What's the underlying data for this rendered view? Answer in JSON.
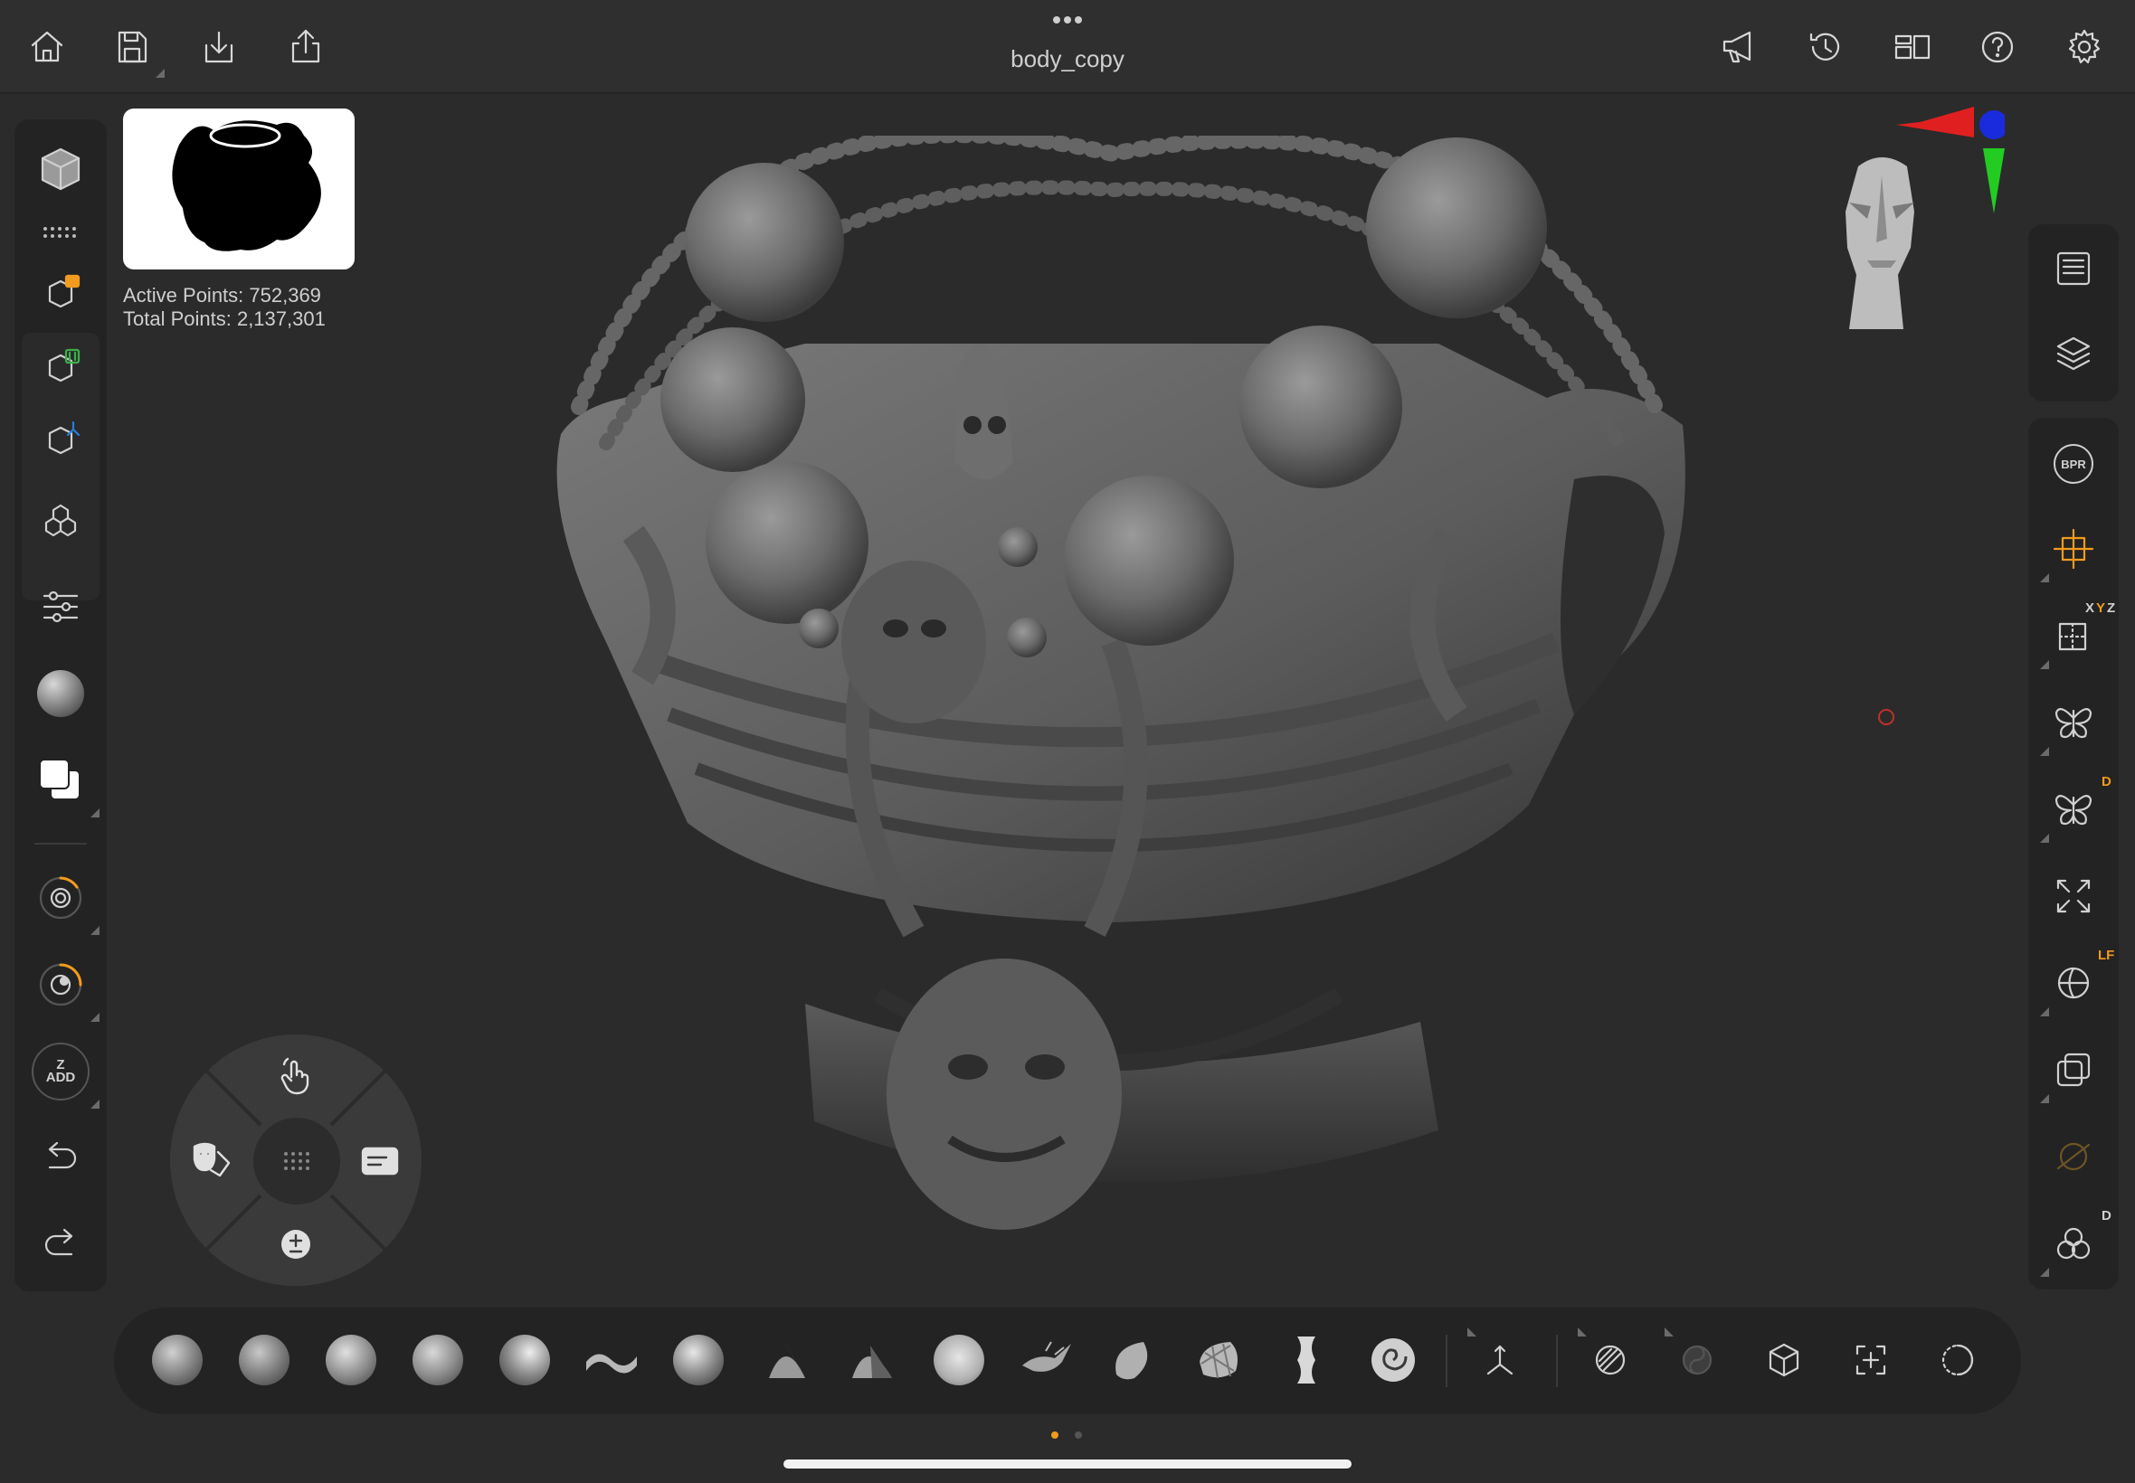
{
  "app": {
    "document_title": "body_copy"
  },
  "stats": {
    "active_points": "Active Points: 752,369",
    "total_points": "Total Points: 2,137,301"
  },
  "left_toolbar": {
    "z_add_top": "Z",
    "z_add_bottom": "ADD"
  },
  "right_toolbar": {
    "bpr_label": "BPR",
    "xyz_badge_x": "X",
    "xyz_badge_y": "Y",
    "xyz_badge_z": "Z",
    "sym_badge": "D",
    "floor_badge": "LF",
    "polyframe_badge": "D"
  },
  "bottom_bar": {
    "brushes": [
      "Clay Buildup",
      "Clay",
      "Standard",
      "Move",
      "Inflate",
      "Dam Standard",
      "Snake Hook",
      "Pinch",
      "Flatten",
      "Smooth",
      "Trim",
      "Blob",
      "Mask Lasso",
      "Slice",
      "Spiral"
    ],
    "page_count": 2,
    "active_page": 1
  },
  "colors": {
    "accent": "#f29b1e",
    "gizmo_x": "#e02020",
    "gizmo_y": "#22cc22",
    "gizmo_z": "#1a2bdd"
  }
}
